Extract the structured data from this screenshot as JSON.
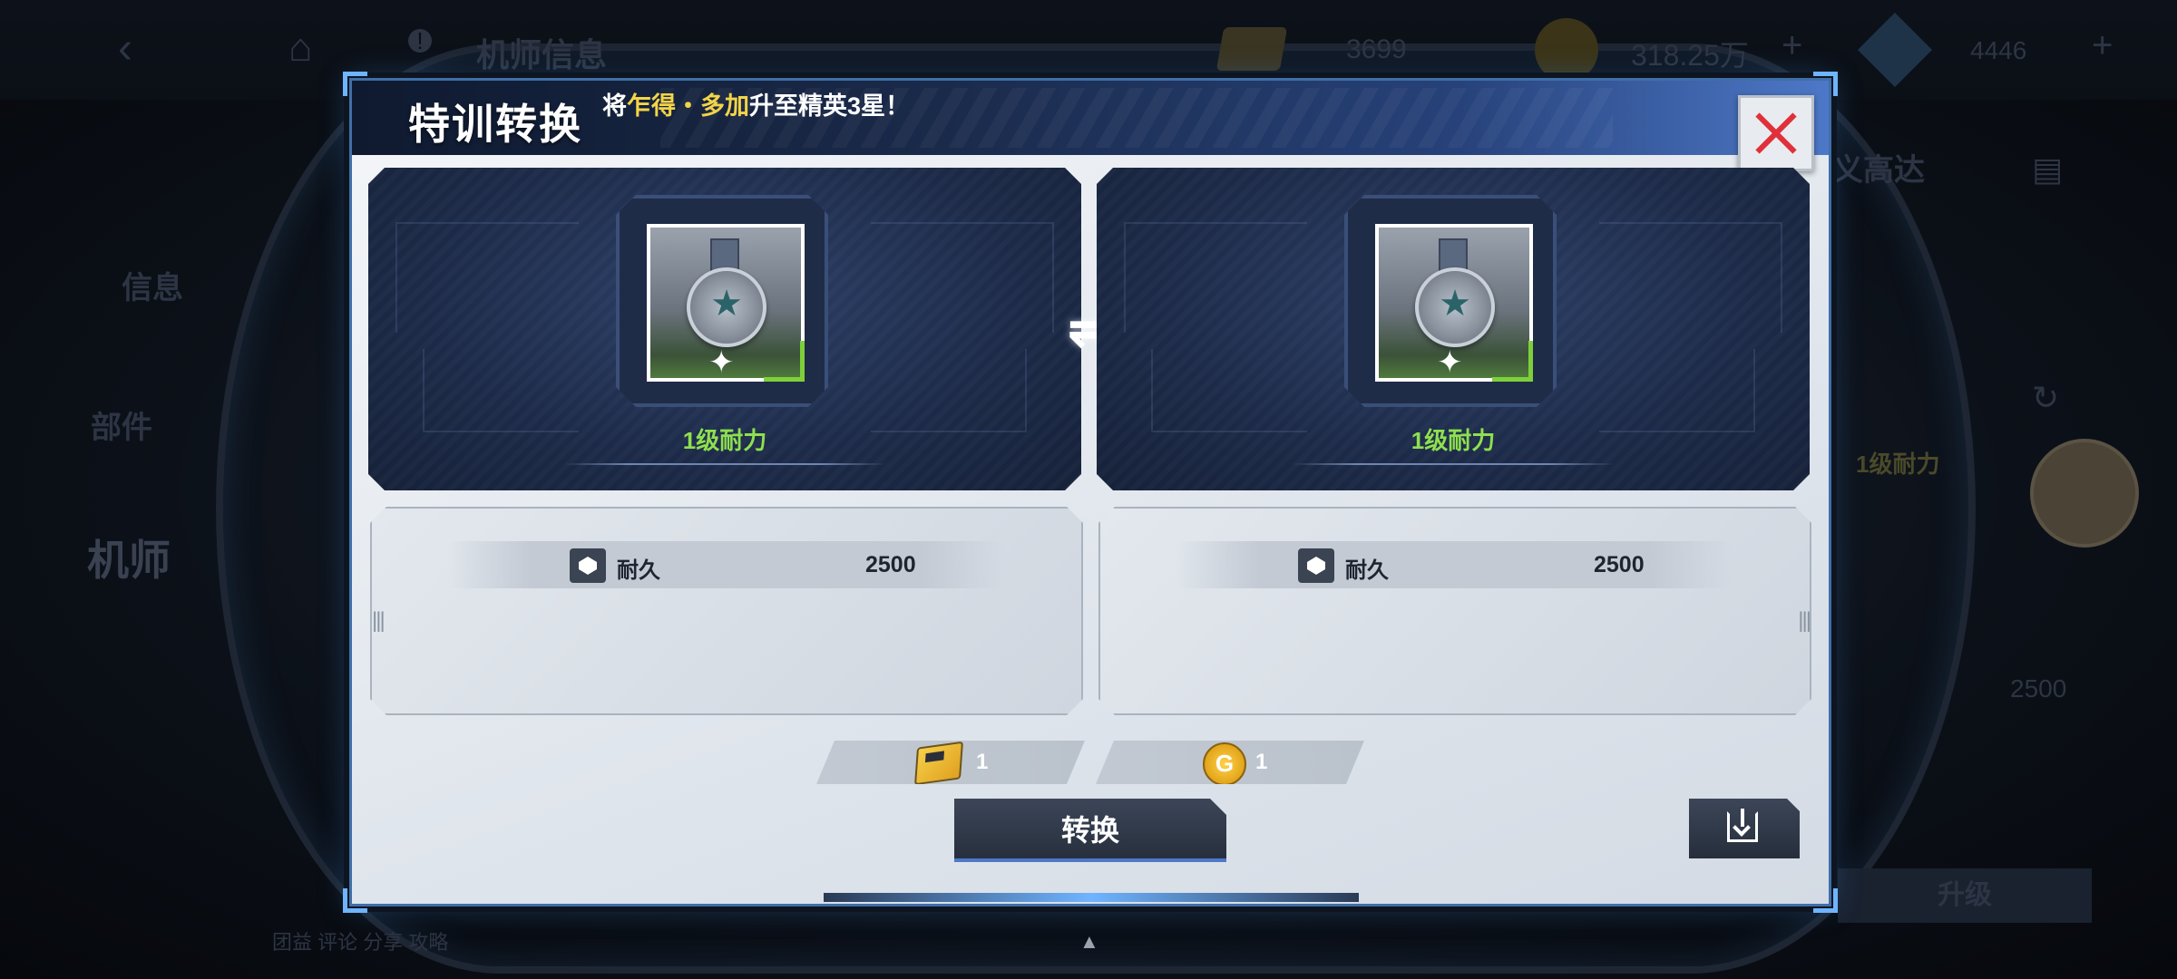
{
  "background": {
    "top_title": "机师信息",
    "disk_count": "3699",
    "coin_amount": "318.25万",
    "gem_count": "4446",
    "side_tabs": [
      "信息",
      "部件",
      "机师"
    ],
    "right_label": "义高达",
    "right_attr": "1级耐力",
    "right_value": "2500",
    "upgrade_label": "升级",
    "bottom_labels": "团益    评论    分享    攻略"
  },
  "dialog": {
    "title": "特训转换",
    "subtitle_prefix": "将",
    "subtitle_highlight": "乍得・多加",
    "subtitle_suffix": "升至精英3星！",
    "left_card": {
      "level_label": "1级耐力",
      "stat_label": "耐久",
      "stat_value": "2500"
    },
    "right_card": {
      "level_label": "1级耐力",
      "stat_label": "耐久",
      "stat_value": "2500"
    },
    "costs": [
      {
        "icon": "disk-icon",
        "amount": "1"
      },
      {
        "icon": "gold-coin-icon",
        "amount": "1"
      }
    ],
    "convert_label": "转换",
    "swap_glyph": "⇌"
  },
  "icons": {
    "close": "close-icon",
    "save": "save-download-icon",
    "swap": "swap-arrows-icon",
    "medal": "medal-star-icon",
    "stat": "durability-icon"
  },
  "colors": {
    "level_green": "#8ee04e",
    "highlight_yellow": "#f4d448",
    "close_red": "#e0303a",
    "header_blue": "#4d78c8"
  }
}
